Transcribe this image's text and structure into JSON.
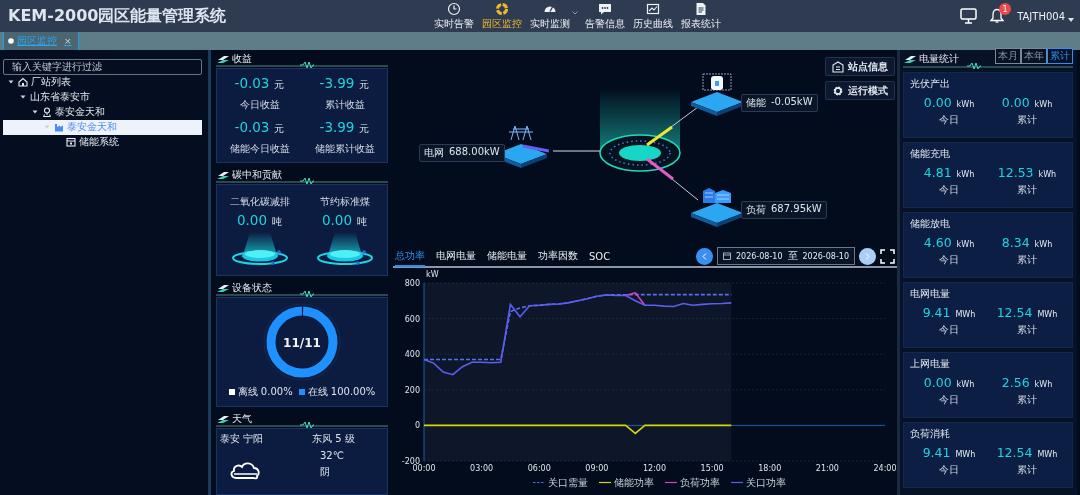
{
  "header": {
    "title": "KEM-2000园区能量管理系统",
    "nav": [
      {
        "label": "实时告警",
        "selected": false,
        "dropdown": false
      },
      {
        "label": "园区监控",
        "selected": true,
        "dropdown": false
      },
      {
        "label": "实时监测",
        "selected": false,
        "dropdown": true
      },
      {
        "label": "告警信息",
        "selected": false,
        "dropdown": false
      },
      {
        "label": "历史曲线",
        "selected": false,
        "dropdown": false
      },
      {
        "label": "报表统计",
        "selected": false,
        "dropdown": false
      }
    ],
    "notification_badge": "1",
    "user": "TAJTH004"
  },
  "open_tabs": [
    {
      "label": "园区监控",
      "close": "×",
      "selected": true
    }
  ],
  "tree": {
    "placeholder": "输入关键字进行过滤",
    "items": [
      {
        "label": "厂站列表",
        "kind": "home",
        "expanded": true,
        "selected": false,
        "children": [
          {
            "label": "山东省泰安市",
            "expanded": true,
            "selected": false,
            "children": [
              {
                "label": "泰安金天和",
                "kind": "site",
                "expanded": true,
                "selected": false,
                "children": [
                  {
                    "label": "泰安金天和",
                    "kind": "plant",
                    "expanded": true,
                    "selected": true,
                    "children": [
                      {
                        "label": "储能系统",
                        "kind": "storage",
                        "selected": false
                      }
                    ]
                  }
                ]
              }
            ]
          }
        ]
      }
    ]
  },
  "revenue": {
    "title": "收益",
    "stats": [
      {
        "value": "-0.03",
        "unit": "元",
        "label": "今日收益"
      },
      {
        "value": "-3.99",
        "unit": "元",
        "label": "累计收益"
      },
      {
        "value": "-0.03",
        "unit": "元",
        "label": "储能今日收益"
      },
      {
        "value": "-3.99",
        "unit": "元",
        "label": "储能累计收益"
      }
    ]
  },
  "carbon": {
    "title": "碳中和贡献",
    "stats": [
      {
        "label": "二氧化碳减排",
        "value": "0.00",
        "unit": "吨"
      },
      {
        "label": "节约标准煤",
        "value": "0.00",
        "unit": "吨"
      }
    ]
  },
  "device_status": {
    "title": "设备状态",
    "center": "11/11",
    "level": 1,
    "legend": [
      {
        "label": "离线 0.00%",
        "color": "#ffffff"
      },
      {
        "label": "在线 100.00%",
        "color": "#1e90ff"
      }
    ]
  },
  "weather": {
    "title": "天气",
    "location": "泰安 宁阳",
    "wind": "东风 5 级",
    "temperature": "32℃",
    "condition": "阴"
  },
  "topology": {
    "buttons": [
      {
        "label": "站点信息"
      },
      {
        "label": "运行模式"
      }
    ],
    "nodes": [
      {
        "kind": "grid",
        "name": "电网",
        "value": "688.00kW"
      },
      {
        "kind": "storage",
        "name": "储能",
        "value": "-0.05kW"
      },
      {
        "kind": "load",
        "name": "负荷",
        "value": "687.95kW"
      }
    ]
  },
  "chart_panel": {
    "tabs": [
      {
        "label": "总功率",
        "selected": true
      },
      {
        "label": "电网电量",
        "selected": false
      },
      {
        "label": "储能电量",
        "selected": false
      },
      {
        "label": "功率因数",
        "selected": false
      },
      {
        "label": "SOC",
        "selected": false
      }
    ],
    "date_from": "2026-08-10",
    "date_separator": "至",
    "date_to": "2026-08-10",
    "chart_data": {
      "type": "line",
      "ylabel": "kW",
      "xlim": [
        0,
        24
      ],
      "ylim": [
        -200,
        800
      ],
      "grid": true,
      "legend": true,
      "bands": [
        {
          "axis": "x",
          "from": 0,
          "to": 16
        }
      ],
      "ref_lines": [
        {
          "axis": "y",
          "value": 0
        }
      ],
      "xticks": [
        {
          "value": 0,
          "label": "00:00"
        },
        {
          "value": 3,
          "label": "03:00"
        },
        {
          "value": 6,
          "label": "06:00"
        },
        {
          "value": 9,
          "label": "09:00"
        },
        {
          "value": 12,
          "label": "12:00"
        },
        {
          "value": 15,
          "label": "15:00"
        },
        {
          "value": 18,
          "label": "18:00"
        },
        {
          "value": 21,
          "label": "21:00"
        },
        {
          "value": 24,
          "label": "24:00"
        }
      ],
      "yticks": [
        -200,
        0,
        200,
        400,
        600,
        800
      ],
      "x": [
        0,
        0.5,
        1,
        1.5,
        2,
        2.5,
        3,
        3.5,
        4,
        4.5,
        5,
        5.5,
        6,
        6.5,
        7,
        7.5,
        8,
        8.5,
        9,
        9.5,
        10,
        10.5,
        11,
        11.5,
        12,
        12.5,
        13,
        13.5,
        14,
        14.5,
        15,
        15.5,
        16
      ],
      "series": [
        {
          "name": "关口需量",
          "color": "#5b6cf0",
          "line_style": "dashed",
          "values": [
            370,
            370,
            370,
            370,
            370,
            370,
            370,
            370,
            370,
            640,
            660,
            672,
            675,
            680,
            682,
            688,
            700,
            712,
            725,
            733,
            733,
            733,
            735,
            735,
            735,
            735,
            735,
            735,
            735,
            735,
            735,
            735,
            735
          ]
        },
        {
          "name": "储能功率",
          "color": "#d4d400",
          "line_style": "solid",
          "values": [
            0,
            0,
            0,
            0,
            0,
            0,
            0,
            0,
            0,
            0,
            0,
            0,
            0,
            0,
            0,
            0,
            0,
            0,
            0,
            0,
            0,
            0,
            -45,
            0,
            0,
            0,
            0,
            0,
            0,
            0,
            0,
            0,
            0
          ]
        },
        {
          "name": "负荷功率",
          "color": "#e040c0",
          "line_style": "solid",
          "values": [
            null,
            null,
            null,
            null,
            null,
            null,
            null,
            null,
            null,
            null,
            null,
            null,
            null,
            null,
            null,
            null,
            null,
            null,
            null,
            null,
            null,
            730,
            745,
            675,
            null,
            null,
            null,
            null,
            null,
            null,
            null,
            null,
            null
          ]
        },
        {
          "name": "关口功率",
          "color": "#5b5ff0",
          "line_style": "solid",
          "values": [
            370,
            350,
            300,
            285,
            330,
            355,
            355,
            352,
            355,
            680,
            610,
            672,
            675,
            680,
            682,
            688,
            700,
            712,
            725,
            733,
            730,
            730,
            700,
            675,
            675,
            670,
            668,
            685,
            675,
            680,
            683,
            685,
            688
          ]
        }
      ]
    }
  },
  "energy_stats": {
    "title": "电量统计",
    "periods": [
      {
        "label": "本月",
        "selected": false
      },
      {
        "label": "本年",
        "selected": false
      },
      {
        "label": "累计",
        "selected": true
      }
    ],
    "cards": [
      {
        "title": "光伏产出",
        "today": {
          "value": "0.00",
          "unit": "kWh",
          "label": "今日"
        },
        "total": {
          "value": "0.00",
          "unit": "kWh",
          "label": "累计"
        }
      },
      {
        "title": "储能充电",
        "today": {
          "value": "4.81",
          "unit": "kWh",
          "label": "今日"
        },
        "total": {
          "value": "12.53",
          "unit": "kWh",
          "label": "累计"
        }
      },
      {
        "title": "储能放电",
        "today": {
          "value": "4.60",
          "unit": "kWh",
          "label": "今日"
        },
        "total": {
          "value": "8.34",
          "unit": "kWh",
          "label": "累计"
        }
      },
      {
        "title": "电网电量",
        "today": {
          "value": "9.41",
          "unit": "MWh",
          "label": "今日"
        },
        "total": {
          "value": "12.54",
          "unit": "MWh",
          "label": "累计"
        }
      },
      {
        "title": "上网电量",
        "today": {
          "value": "0.00",
          "unit": "kWh",
          "label": "今日"
        },
        "total": {
          "value": "2.56",
          "unit": "kWh",
          "label": "累计"
        }
      },
      {
        "title": "负荷消耗",
        "today": {
          "value": "9.41",
          "unit": "MWh",
          "label": "今日"
        },
        "total": {
          "value": "12.54",
          "unit": "MWh",
          "label": "累计"
        }
      }
    ]
  }
}
